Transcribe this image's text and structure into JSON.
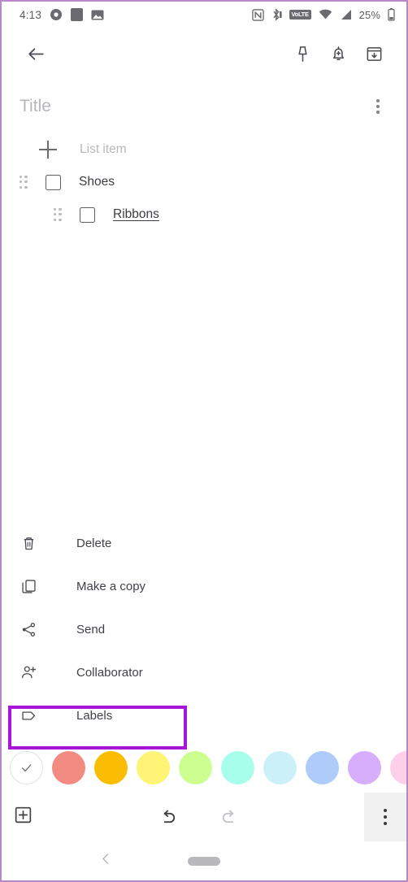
{
  "status_bar": {
    "time": "4:13",
    "left_icons": [
      "alarm-clock-icon",
      "screen-record-icon",
      "image-icon"
    ],
    "right_icons": [
      "nfc-icon",
      "bluetooth-icon",
      "volte-icon",
      "wifi-icon",
      "signal-icon"
    ],
    "volte_label": "VoLTE",
    "battery_percent": "25%"
  },
  "appbar": {
    "back": "back-arrow",
    "pin": "pin",
    "reminder": "add-reminder",
    "archive": "archive"
  },
  "note": {
    "title_placeholder": "Title",
    "overflow": "more-options",
    "rows": [
      {
        "type": "add",
        "label": "List item",
        "indent": false
      },
      {
        "type": "item",
        "label": "Shoes",
        "indent": false,
        "checked": false,
        "underlined": false
      },
      {
        "type": "item",
        "label": "Ribbons",
        "indent": true,
        "checked": false,
        "underlined": true
      }
    ]
  },
  "menu": {
    "items": [
      {
        "icon": "trash-icon",
        "label": "Delete",
        "highlighted": false
      },
      {
        "icon": "copy-icon",
        "label": "Make a copy",
        "highlighted": false
      },
      {
        "icon": "share-icon",
        "label": "Send",
        "highlighted": false
      },
      {
        "icon": "person-add-icon",
        "label": "Collaborator",
        "highlighted": false
      },
      {
        "icon": "label-tag-icon",
        "label": "Labels",
        "highlighted": true
      }
    ],
    "highlight_color": "#a715d8"
  },
  "colors": {
    "swatches": [
      {
        "name": "default-none",
        "hex": "#ffffff",
        "selected": true
      },
      {
        "name": "coral",
        "hex": "#f28b82",
        "selected": false
      },
      {
        "name": "amber",
        "hex": "#fbbc04",
        "selected": false
      },
      {
        "name": "yellow",
        "hex": "#fff475",
        "selected": false
      },
      {
        "name": "green",
        "hex": "#ccff90",
        "selected": false
      },
      {
        "name": "teal",
        "hex": "#a7ffeb",
        "selected": false
      },
      {
        "name": "light-blue",
        "hex": "#cbf0f8",
        "selected": false
      },
      {
        "name": "blue",
        "hex": "#aecbfa",
        "selected": false
      },
      {
        "name": "purple",
        "hex": "#d7aefb",
        "selected": false
      },
      {
        "name": "pink",
        "hex": "#fdcfe8",
        "selected": false
      }
    ]
  },
  "bottom_toolbar": {
    "add": "add-box",
    "undo": "undo",
    "redo": "redo",
    "overflow": "more-options",
    "undo_enabled": true,
    "redo_enabled": false
  },
  "nav_bar": {
    "back": "nav-back",
    "home": "nav-home-pill"
  }
}
